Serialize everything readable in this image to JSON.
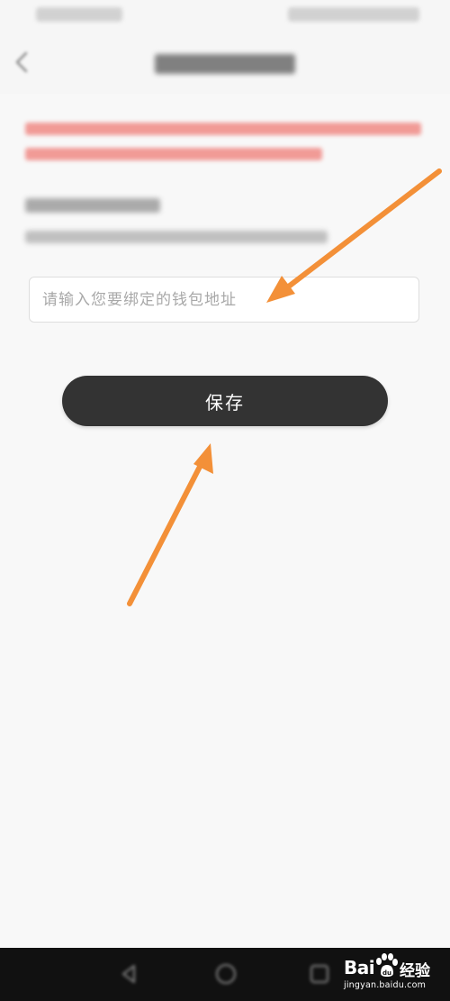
{
  "form": {
    "address_placeholder": "请输入您要绑定的钱包地址",
    "address_value": ""
  },
  "actions": {
    "save_label": "保存"
  },
  "watermark": {
    "logo": "Bai",
    "brand": "经验",
    "url": "jingyan.baidu.com"
  },
  "colors": {
    "primary_button": "#333333",
    "notice_text": "#f08b86",
    "annotation_arrow": "#f39038",
    "background": "#f8f8f8"
  },
  "icons": {
    "back": "chevron-left-icon",
    "nav_back": "triangle-back-icon",
    "nav_home": "circle-home-icon",
    "nav_recent": "square-recent-icon"
  }
}
